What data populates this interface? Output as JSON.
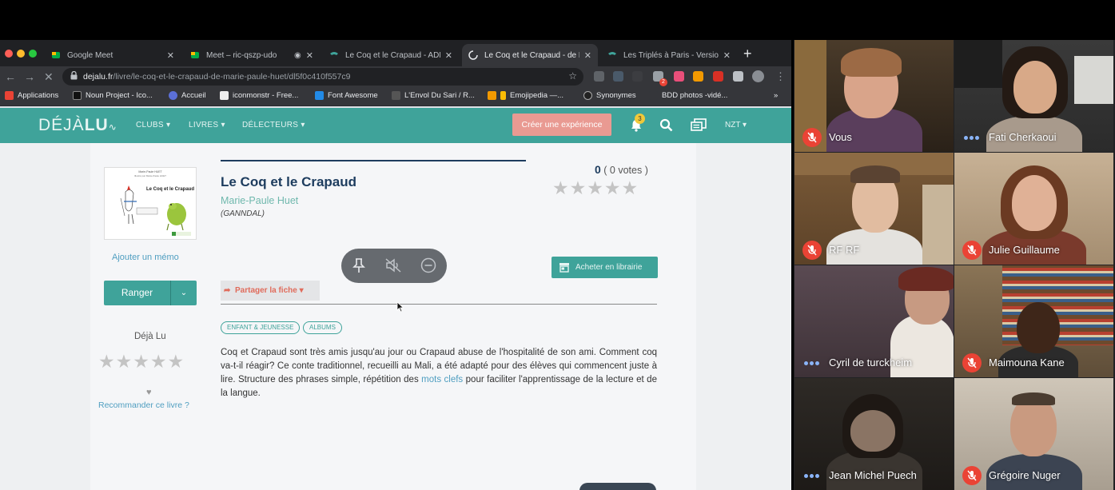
{
  "browser": {
    "tabs": [
      {
        "label": "Google Meet",
        "active": false
      },
      {
        "label": "Meet – ric-qszp-udo",
        "active": false
      },
      {
        "label": "",
        "active": false
      },
      {
        "label": "Le Coq et le Crapaud - ADIF",
        "active": false
      },
      {
        "label": "Le Coq et le Crapaud - de M",
        "active": true
      },
      {
        "label": "Les Triplés à Paris - Version",
        "active": false
      }
    ],
    "new_tab": "+",
    "url_host": "dejalu.fr",
    "url_path": "/livre/le-coq-et-le-crapaud-de-marie-paule-huet/dl5f0c410f557c9",
    "extension_badge": "2",
    "bookmarks": [
      "Applications",
      "Noun Project - Ico...",
      "Accueil",
      "iconmonstr - Free...",
      "Font Awesome",
      "L'Envol Du Sari / R...",
      "Emojipedia —...",
      "Synonymes",
      "BDD photos -vidé..."
    ],
    "bookmarks_more": "»"
  },
  "site": {
    "logo_left": "DÉJÀ",
    "logo_right": "LU",
    "nav": {
      "clubs": "CLUBS",
      "livres": "LIVRES",
      "delecteurs": "DÉLECTEURS",
      "cta": "Créer une expérience",
      "notif_count": "3",
      "lang": "NZT"
    },
    "book": {
      "title": "Le Coq et le Crapaud",
      "author": "Marie-Paule Huet",
      "publisher": "(GANNDAL)",
      "cover_caption": "Le Coq et le Crapaud",
      "cover_author": "Marie-Paule HUET",
      "cover_illustrator": "Illustré par Marie-Paule HUET",
      "vote_score": "0",
      "vote_text": "( 0 votes )",
      "rating_value": 0,
      "rating_max": 5,
      "add_memo": "Ajouter un mémo",
      "ranger": "Ranger",
      "deja_lu": "Déjà Lu",
      "recommend": "Recommander ce livre ?",
      "buy": "Acheter en librairie",
      "share": "Partager la fiche",
      "tags": [
        "ENFANT & JEUNESSE",
        "ALBUMS"
      ],
      "description_start": "Coq et Crapaud sont très amis jusqu'au jour ou Crapaud abuse de l'hospitalité de son ami. Comment coq va-t-il réagir? Ce conte traditionnel, recueilli au Mali, a été adapté pour des élèves qui commencent juste à lire. Structure des phrases simple, répétition des ",
      "description_link": "mots clefs",
      "description_end": " pour faciliter l'apprentissage de la lecture et de la langue."
    }
  },
  "meet": {
    "participants": [
      {
        "name": "Vous",
        "muted": true
      },
      {
        "name": "Fati Cherkaoui",
        "muted": false
      },
      {
        "name": "RF RF",
        "muted": true
      },
      {
        "name": "Julie Guillaume",
        "muted": true
      },
      {
        "name": "Cyril de turckheim",
        "muted": false
      },
      {
        "name": "Maimouna Kane",
        "muted": true
      },
      {
        "name": "Jean Michel Puech",
        "muted": false
      },
      {
        "name": "Grégoire Nuger",
        "muted": true
      }
    ]
  }
}
